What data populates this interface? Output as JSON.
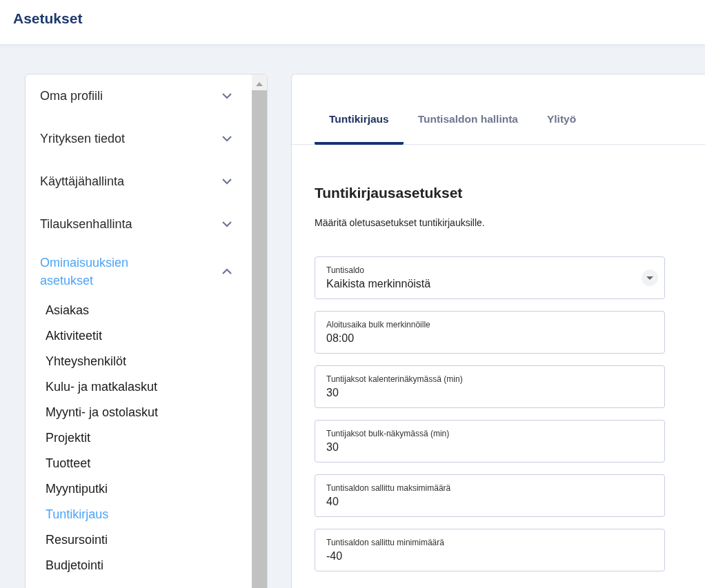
{
  "header": {
    "title": "Asetukset"
  },
  "sidebar": {
    "sections": [
      {
        "label": "Oma profiili",
        "expanded": false
      },
      {
        "label": "Yrityksen tiedot",
        "expanded": false
      },
      {
        "label": "Käyttäjähallinta",
        "expanded": false
      },
      {
        "label": "Tilauksenhallinta",
        "expanded": false
      },
      {
        "label": "Ominaisuuksien asetukset",
        "expanded": true,
        "children": [
          {
            "label": "Asiakas",
            "selected": false
          },
          {
            "label": "Aktiviteetit",
            "selected": false
          },
          {
            "label": "Yhteyshenkilöt",
            "selected": false
          },
          {
            "label": "Kulu- ja matkalaskut",
            "selected": false
          },
          {
            "label": "Myynti- ja ostolaskut",
            "selected": false
          },
          {
            "label": "Projektit",
            "selected": false
          },
          {
            "label": "Tuotteet",
            "selected": false
          },
          {
            "label": "Myyntiputki",
            "selected": false
          },
          {
            "label": "Tuntikirjaus",
            "selected": true
          },
          {
            "label": "Resursointi",
            "selected": false
          },
          {
            "label": "Budjetointi",
            "selected": false
          }
        ]
      }
    ]
  },
  "tabs": [
    {
      "label": "Tuntikirjaus",
      "selected": true
    },
    {
      "label": "Tuntisaldon hallinta",
      "selected": false
    },
    {
      "label": "Ylityö",
      "selected": false
    }
  ],
  "settings": {
    "heading": "Tuntikirjausasetukset",
    "description": "Määritä oletusasetukset tuntikirjauksille.",
    "fields": [
      {
        "kind": "select",
        "label": "Tuntisaldo",
        "value": "Kaikista merkinnöistä"
      },
      {
        "kind": "input",
        "label": "Aloitusaika bulk merkinnöille",
        "value": "08:00"
      },
      {
        "kind": "input",
        "label": "Tuntijaksot kalenterinäkymässä (min)",
        "value": "30"
      },
      {
        "kind": "input",
        "label": "Tuntijaksot bulk-näkymässä (min)",
        "value": "30"
      },
      {
        "kind": "input",
        "label": "Tuntisaldon sallittu maksimimäärä",
        "value": "40"
      },
      {
        "kind": "input",
        "label": "Tuntisaldon sallittu minimimäärä",
        "value": "-40"
      }
    ]
  }
}
